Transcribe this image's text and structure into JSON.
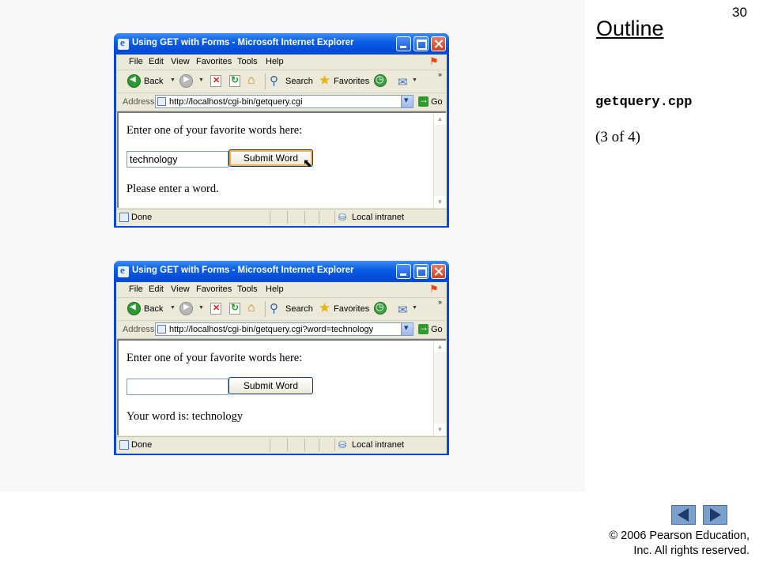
{
  "slide": {
    "page_number": "30",
    "outline_title": "Outline",
    "filename": "getquery.cpp",
    "part": "(3 of 4)",
    "copyright_line1": "© 2006 Pearson Education,",
    "copyright_line2": "Inc.  All rights reserved."
  },
  "browser": {
    "title": "Using GET with Forms - Microsoft Internet Explorer",
    "menu": [
      "File",
      "Edit",
      "View",
      "Favorites",
      "Tools",
      "Help"
    ],
    "toolbar": {
      "back": "Back",
      "search": "Search",
      "favorites": "Favorites"
    },
    "address_label": "Address",
    "go_label": "Go",
    "status_text": "Done",
    "zone_text": "Local intranet"
  },
  "window1": {
    "url": "http://localhost/cgi-bin/getquery.cgi",
    "heading": "Enter one of your favorite words here:",
    "input_value": "technology",
    "button_label": "Submit Word",
    "message": "Please enter a word."
  },
  "window2": {
    "url": "http://localhost/cgi-bin/getquery.cgi?word=technology",
    "heading": "Enter one of your favorite words here:",
    "input_value": "",
    "button_label": "Submit Word",
    "message": "Your word is: technology"
  },
  "icons": {
    "prev": "previous-slide-icon",
    "next": "next-slide-icon"
  },
  "colors": {
    "titlebar": "#0349d7",
    "nav_button": "#7aa0cc",
    "panel_bg": "#f7f7f7"
  }
}
